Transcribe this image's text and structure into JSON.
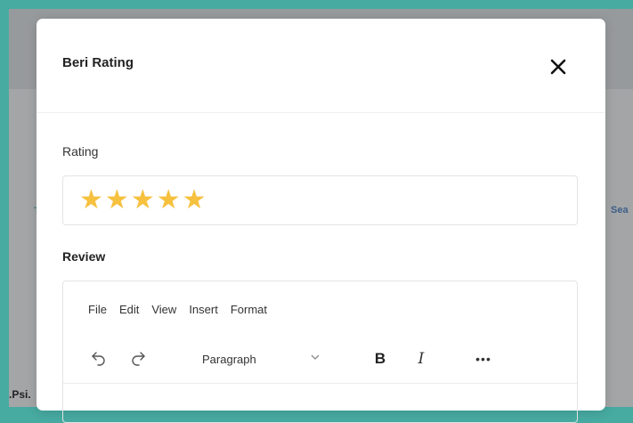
{
  "background": {
    "left_fragment": "T",
    "right_fragment": "Sea",
    "bottom_fragment": ".Psi."
  },
  "modal": {
    "title": "Beri Rating",
    "close_icon": "close-icon",
    "rating_label": "Rating",
    "rating": {
      "value": 5,
      "max": 5,
      "star_char": "★"
    },
    "review_label": "Review"
  },
  "editor": {
    "menu": [
      "File",
      "Edit",
      "View",
      "Insert",
      "Format"
    ],
    "toolbar": {
      "undo_icon": "undo-icon",
      "redo_icon": "redo-icon",
      "block_format": "Paragraph",
      "bold": "B",
      "italic": "I",
      "more": "•••"
    }
  },
  "colors": {
    "page_accent": "#47aba2",
    "star": "#f6c13f"
  }
}
